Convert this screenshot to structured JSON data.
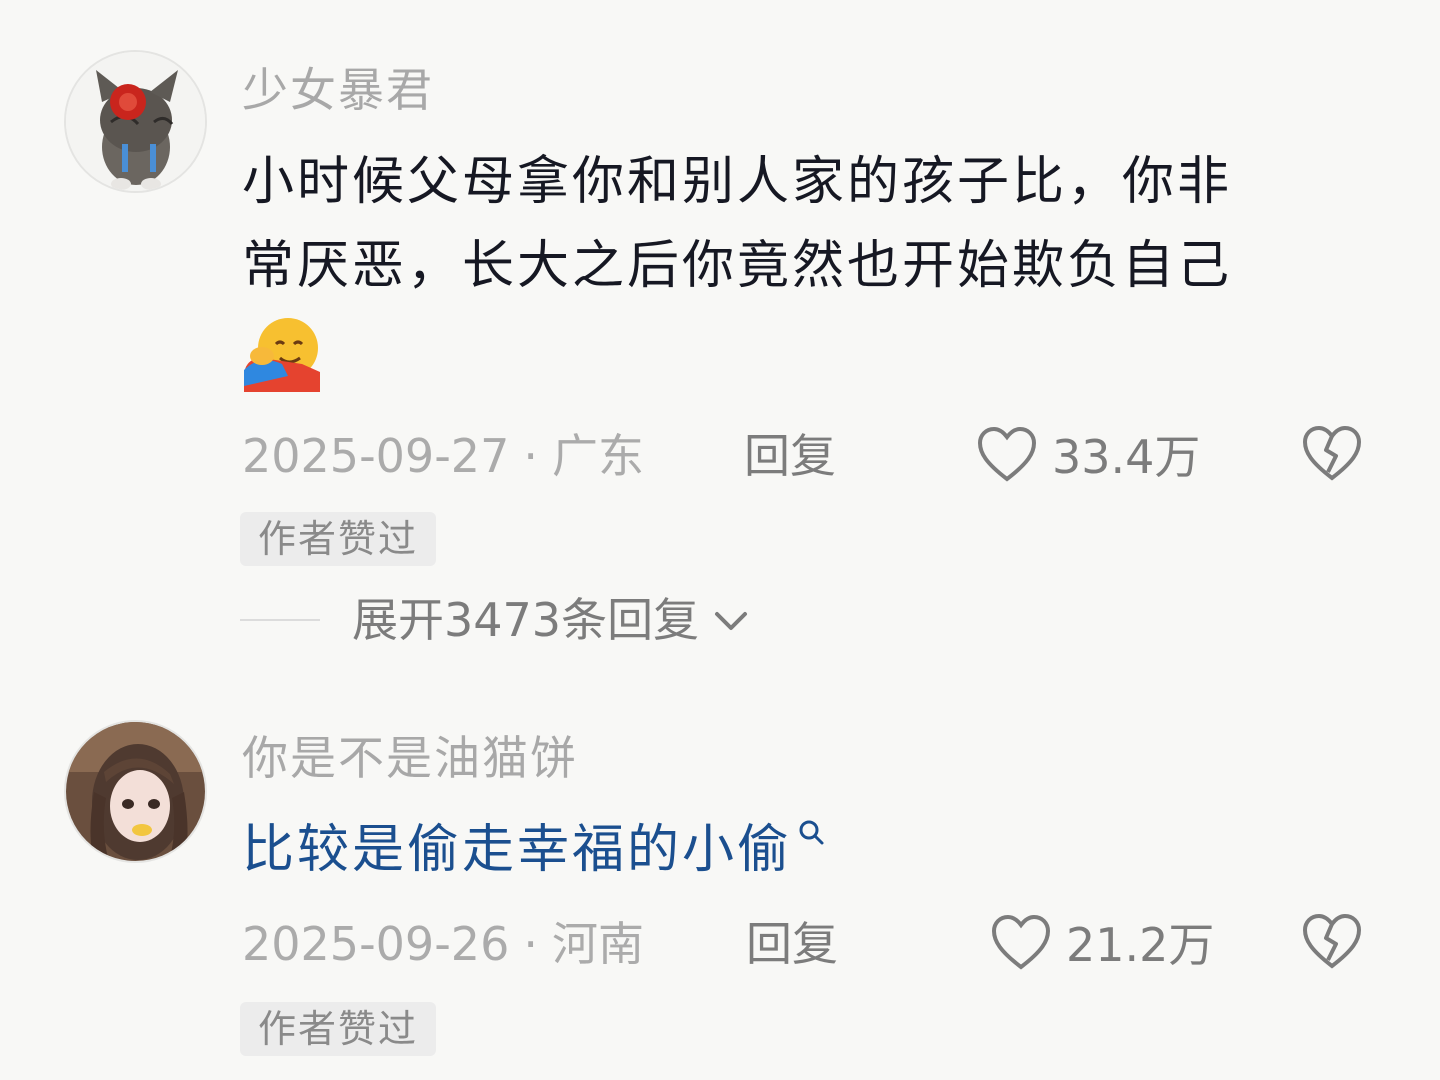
{
  "comments": [
    {
      "username": "少女暴君",
      "avatar": "kitten-with-red-flower",
      "lines": [
        "小时候父母拿你和别人家的孩子比，你非",
        "常厌恶，长大之后你竟然也开始欺负自己"
      ],
      "emoji": "hugging-face-emoji",
      "date": "2025-09-27",
      "separator": "·",
      "location": "广东",
      "reply_label": "回复",
      "like_count": "33.4万",
      "badge": "作者赞过",
      "expand_label": "展开3473条回复"
    },
    {
      "username": "你是不是油猫饼",
      "avatar": "girl-photo",
      "text": "比较是偷走幸福的小偷",
      "date": "2025-09-26",
      "separator": "·",
      "location": "河南",
      "reply_label": "回复",
      "like_count": "21.2万",
      "badge": "作者赞过"
    }
  ],
  "colors": {
    "background": "#f8f8f6",
    "text": "#161823",
    "muted": "#ababab",
    "link": "#1b4f8f"
  }
}
